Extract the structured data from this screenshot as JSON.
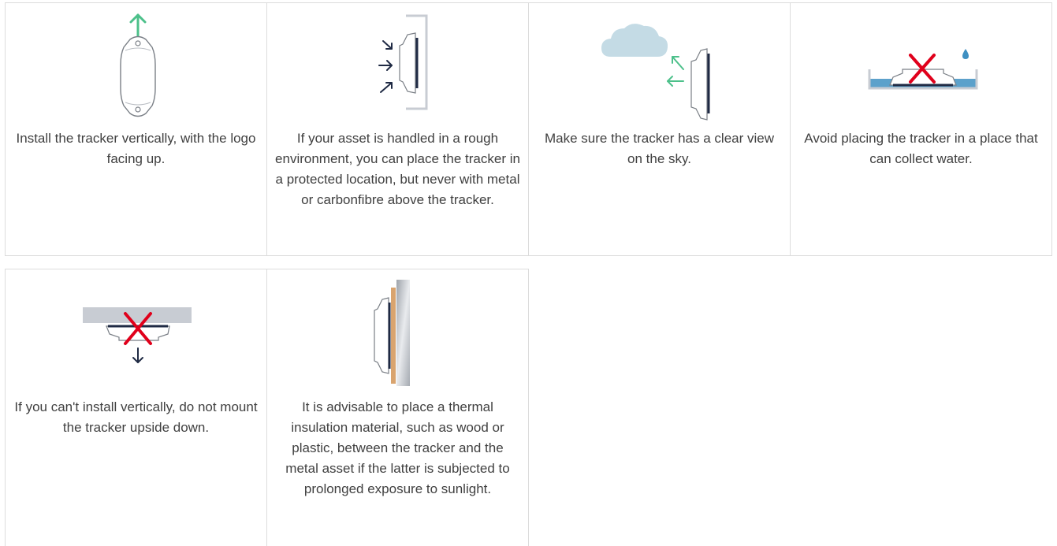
{
  "tips": [
    {
      "caption": "Install the tracker vertically, with the logo facing up.",
      "illustration": "tracker-vertical-up-arrow"
    },
    {
      "caption": "If your asset is handled in a rough environment, you can place the tracker in a protected location, but never with metal or carbonfibre above the tracker.",
      "illustration": "tracker-protected-location"
    },
    {
      "caption": "Make sure the tracker has a clear view on the sky.",
      "illustration": "tracker-clear-sky-view"
    },
    {
      "caption": "Avoid placing the tracker in a place that can collect water.",
      "illustration": "tracker-water-collection-forbidden"
    },
    {
      "caption": "If you can't install vertically, do not mount the tracker upside down.",
      "illustration": "tracker-upside-down-forbidden"
    },
    {
      "caption": "It is advisable to place a thermal insulation material, such as wood or plastic, between the tracker and the metal asset if the latter is subjected to prolonged exposure to sunlight.",
      "illustration": "tracker-thermal-insulation"
    }
  ],
  "colors": {
    "green_arrow": "#4cc08a",
    "navy": "#1f2a44",
    "red_cross": "#e0001b",
    "cloud": "#c4dbe5",
    "water": "#3f90c2",
    "wall_gray": "#c8ccd3",
    "wood": "#d9a46f",
    "border": "#dcdcdc"
  }
}
